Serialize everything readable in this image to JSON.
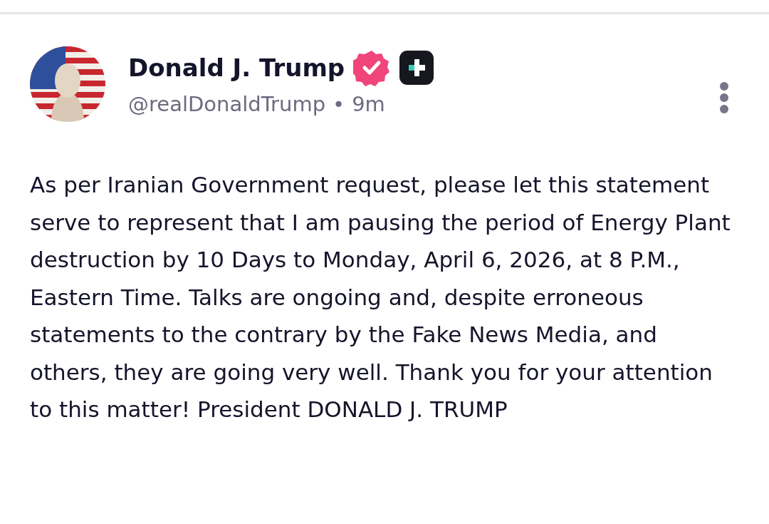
{
  "post": {
    "author": "Donald J. Trump",
    "verified": true,
    "handle": "@realDonaldTrump",
    "separator": "•",
    "time": "9m",
    "body": "As per Iranian Government request, please let this statement serve to represent that I am pausing the period of Energy Plant destruction by 10 Days to Monday, April 6, 2026, at 8 P.M., Eastern Time. Talks are ongoing and, despite erroneous statements to the contrary by the Fake News Media, and others, they are going very well. Thank you for your attention to this matter! President DONALD J. TRUMP"
  }
}
